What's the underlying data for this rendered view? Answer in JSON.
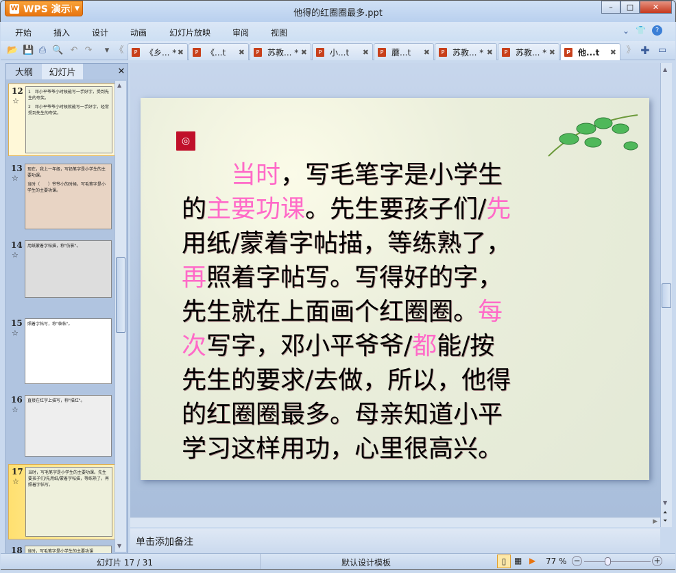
{
  "app": {
    "brand": "WPS 演示",
    "title": "他得的红圈圈最多.ppt"
  },
  "window": {
    "minimize": "–",
    "maximize": "□",
    "close": "✕"
  },
  "menu": [
    "开始",
    "插入",
    "设计",
    "动画",
    "幻灯片放映",
    "审阅",
    "视图"
  ],
  "toolbar_icons": [
    "open-icon",
    "save-icon",
    "print-icon",
    "print-preview-icon",
    "undo-icon",
    "redo-icon",
    "dropdown-icon",
    "tabs-left-icon"
  ],
  "tabs": [
    {
      "label": "《乡... *",
      "active": false
    },
    {
      "label": "《...t",
      "active": false
    },
    {
      "label": "苏教... *",
      "active": false
    },
    {
      "label": "小...t",
      "active": false
    },
    {
      "label": "蘑...t",
      "active": false
    },
    {
      "label": "苏教... *",
      "active": false
    },
    {
      "label": "苏教... *",
      "active": false
    },
    {
      "label": "他...t",
      "active": true
    }
  ],
  "panel": {
    "tab_outline": "大纲",
    "tab_slides": "幻灯片",
    "close": "✕"
  },
  "thumbs": [
    {
      "num": "12",
      "lines": [
        "1　邓小平爷爷小时候能写一手好字，受到先生的夸奖。",
        "2　邓小平爷爷小时候就能写一手好字，经常受到先生的夸奖。"
      ]
    },
    {
      "num": "13",
      "lines": [
        "现在，我上一年级，写铅笔字是小学生的主要功课。",
        "当时（　　）爷爷小的时候，写毛笔字是小学生的主要功课。"
      ]
    },
    {
      "num": "14",
      "lines": [
        "用纸蒙着字帖描，称\"仿影\"。"
      ]
    },
    {
      "num": "15",
      "lines": [
        "照着字帖写，称\"临帖\"。"
      ]
    },
    {
      "num": "16",
      "lines": [
        "直接在红字上描写，称\"描红\"。"
      ]
    },
    {
      "num": "17",
      "lines": [
        "当时，写毛笔字是小学生的主要功课。先生要孩子们/先用纸/蒙着字帖描，等练熟了，再照着字帖写。"
      ]
    },
    {
      "num": "18",
      "lines": [
        "当时，写毛笔字是小学生的主要功课"
      ]
    }
  ],
  "slide": {
    "lines": [
      [
        {
          "t": "　　"
        },
        {
          "t": "当时",
          "p": 1
        },
        {
          "t": "，写毛笔字是小学生"
        }
      ],
      [
        {
          "t": "的"
        },
        {
          "t": "主要功课",
          "p": 1
        },
        {
          "t": "。先生要孩子们/"
        },
        {
          "t": "先",
          "p": 1
        }
      ],
      [
        {
          "t": "用纸/蒙着字帖描，等练熟了，"
        }
      ],
      [
        {
          "t": "再",
          "p": 1
        },
        {
          "t": "照着字帖写。写得好的字，"
        }
      ],
      [
        {
          "t": "先生就在上面画个红圈圈。"
        },
        {
          "t": "每",
          "p": 1
        }
      ],
      [
        {
          "t": "次",
          "p": 1
        },
        {
          "t": "写字，邓小平爷爷/"
        },
        {
          "t": "都",
          "p": 1
        },
        {
          "t": "能/按"
        }
      ],
      [
        {
          "t": "先生的要求/去做，所以，他得"
        }
      ],
      [
        {
          "t": "的红圈圈最多。母亲知道小平"
        }
      ],
      [
        {
          "t": "学习这样用功，心里很高兴。"
        }
      ]
    ]
  },
  "notes": "单击添加备注",
  "status": {
    "slide": "幻灯片 17 / 31",
    "template": "默认设计模板",
    "zoom": "77 %",
    "zoom_value": 77
  },
  "colors": {
    "accent": "#ff6ac8",
    "brand": "#e8740f"
  }
}
